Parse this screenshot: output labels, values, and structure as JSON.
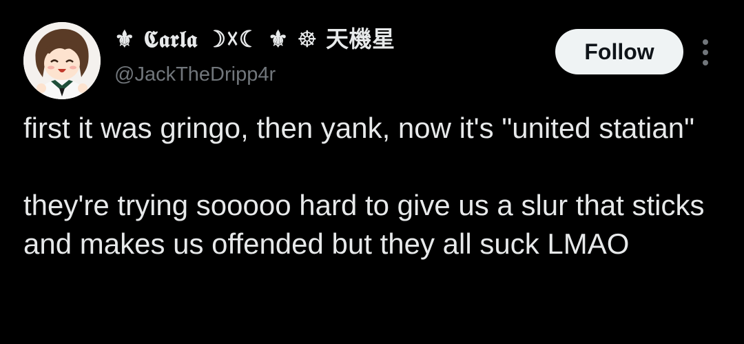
{
  "tweet": {
    "author": {
      "display_name": "⚜ 𝕮𝖆𝖗𝖑𝖆 ☽☓☾ ⚜ ☸ 天機星",
      "handle": "@JackTheDripp4r",
      "avatar_icon": "anime-girl-avatar"
    },
    "follow_label": "Follow",
    "more_icon": "more-vertical-icon",
    "text": "first it was gringo, then yank, now it's \"united statian\"\n\nthey're trying sooooo hard to give us a slur that sticks and makes us offended but they all suck LMAO"
  },
  "colors": {
    "background": "#000000",
    "primary_text": "#e7e9ea",
    "secondary_text": "#71767b",
    "follow_bg": "#eff3f4",
    "follow_text": "#0f1419"
  }
}
